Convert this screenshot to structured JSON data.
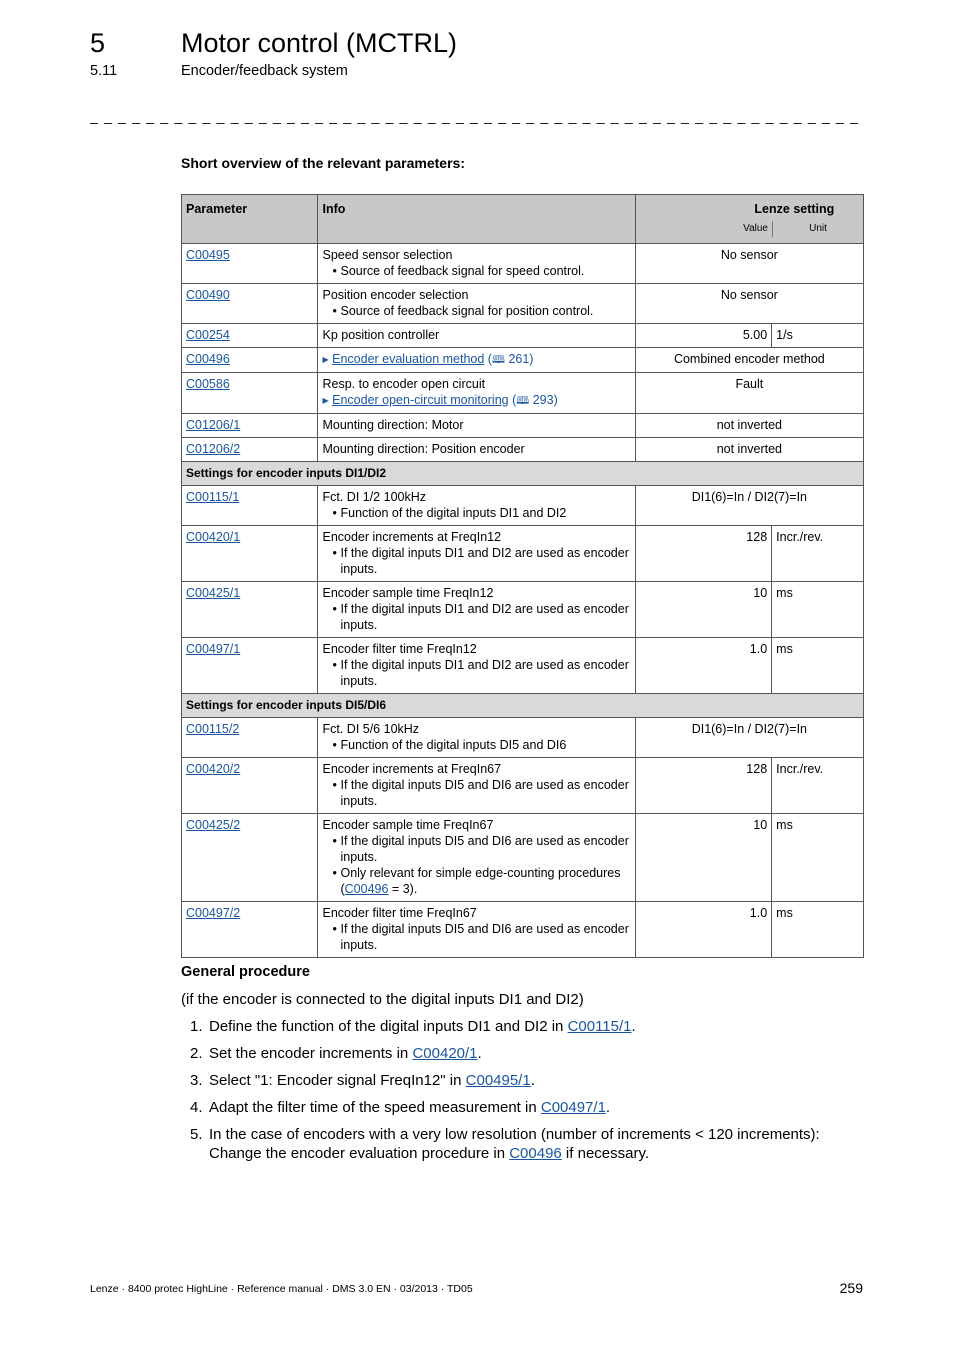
{
  "header": {
    "chapter_number": "5",
    "chapter_title": "Motor control (MCTRL)",
    "section_number": "5.11",
    "section_title": "Encoder/feedback system",
    "separator": "_ _ _ _ _ _ _ _ _ _ _ _ _ _ _ _ _ _ _ _ _ _ _ _ _ _ _ _ _ _ _ _ _ _ _ _ _ _ _ _ _ _ _ _ _ _ _ _ _ _ _ _ _ _ _ _ _ _ _ _ _ _ _ _ _ _"
  },
  "overview_title": "Short overview of the relevant parameters:",
  "table": {
    "headers": {
      "parameter": "Parameter",
      "info": "Info",
      "lenze_setting": "Lenze setting",
      "value": "Value",
      "unit": "Unit"
    },
    "rows": [
      {
        "param": "C00495",
        "info": "Speed sensor selection",
        "bullets": [
          "Source of feedback signal for speed control."
        ],
        "setting": "No sensor"
      },
      {
        "param": "C00490",
        "info": "Position encoder selection",
        "bullets": [
          "Source of feedback signal for position control."
        ],
        "setting": "No sensor"
      },
      {
        "param": "C00254",
        "info": "Kp position controller",
        "value": "5.00",
        "unit": "1/s"
      },
      {
        "param": "C00496",
        "link_text": "Encoder evaluation method",
        "link_page": "261",
        "setting": "Combined encoder method"
      },
      {
        "param": "C00586",
        "info": "Resp. to encoder open circuit",
        "link_text": "Encoder open-circuit monitoring",
        "link_page": "293",
        "setting": "Fault"
      },
      {
        "param": "C01206/1",
        "info": "Mounting direction: Motor",
        "setting": "not inverted"
      },
      {
        "param": "C01206/2",
        "info": "Mounting direction: Position encoder",
        "setting": "not inverted"
      }
    ],
    "group1": {
      "title": "Settings for encoder inputs DI1/DI2",
      "rows": [
        {
          "param": "C00115/1",
          "info": "Fct. DI 1/2 100kHz",
          "bullets": [
            "Function of the digital inputs DI1 and DI2"
          ],
          "setting": "DI1(6)=In / DI2(7)=In"
        },
        {
          "param": "C00420/1",
          "info": "Encoder increments at FreqIn12",
          "bullets": [
            "If the digital inputs DI1 and DI2 are used as encoder inputs."
          ],
          "value": "128",
          "unit": "Incr./rev."
        },
        {
          "param": "C00425/1",
          "info": "Encoder sample time FreqIn12",
          "bullets": [
            "If the digital inputs DI1 and DI2 are used as encoder inputs."
          ],
          "value": "10",
          "unit": "ms"
        },
        {
          "param": "C00497/1",
          "info": "Encoder filter time FreqIn12",
          "bullets": [
            "If the digital inputs DI1 and DI2 are used as encoder inputs."
          ],
          "value": "1.0",
          "unit": "ms"
        }
      ]
    },
    "group2": {
      "title": "Settings for encoder inputs DI5/DI6",
      "rows": [
        {
          "param": "C00115/2",
          "info": "Fct. DI 5/6 10kHz",
          "bullets": [
            "Function of the digital inputs DI5 and DI6"
          ],
          "setting": "DI1(6)=In / DI2(7)=In"
        },
        {
          "param": "C00420/2",
          "info": "Encoder increments at FreqIn67",
          "bullets": [
            "If the digital inputs DI5 and DI6 are used as encoder inputs."
          ],
          "value": "128",
          "unit": "Incr./rev."
        },
        {
          "param": "C00425/2",
          "info": "Encoder sample time FreqIn67",
          "bullets": [
            "If the digital inputs DI5 and DI6 are used as encoder inputs."
          ],
          "bullet2_pre": "Only relevant for simple edge-counting procedures (",
          "bullet2_link": "C00496",
          "bullet2_post": " = 3).",
          "value": "10",
          "unit": "ms"
        },
        {
          "param": "C00497/2",
          "info": "Encoder filter time FreqIn67",
          "bullets": [
            "If the digital inputs DI5 and DI6 are used as encoder inputs."
          ],
          "value": "1.0",
          "unit": "ms"
        }
      ]
    }
  },
  "general_procedure": {
    "title": "General procedure",
    "subtitle": "(if the encoder is connected to the digital inputs DI1 and DI2)",
    "steps": [
      {
        "num": "1.",
        "pre": "Define the function of the digital inputs DI1 and DI2 in ",
        "link": "C00115/1",
        "post": "."
      },
      {
        "num": "2.",
        "pre": "Set the encoder increments in ",
        "link": "C00420/1",
        "post": "."
      },
      {
        "num": "3.",
        "pre": "Select \"1: Encoder signal FreqIn12\" in ",
        "link": "C00495/1",
        "post": "."
      },
      {
        "num": "4.",
        "pre": "Adapt the filter time of the speed measurement in ",
        "link": "C00497/1",
        "post": "."
      },
      {
        "num": "5.",
        "pre": "In the case of encoders with a very low resolution (number of increments < 120 increments): Change the encoder evaluation procedure in ",
        "link": "C00496",
        "post": " if necessary."
      }
    ]
  },
  "footer": {
    "text": "Lenze · 8400 protec HighLine · Reference manual · DMS 3.0 EN · 03/2013 · TD05",
    "page": "259"
  },
  "icons": {
    "bullet": "•",
    "arrow": "▶",
    "book": "🕮"
  }
}
